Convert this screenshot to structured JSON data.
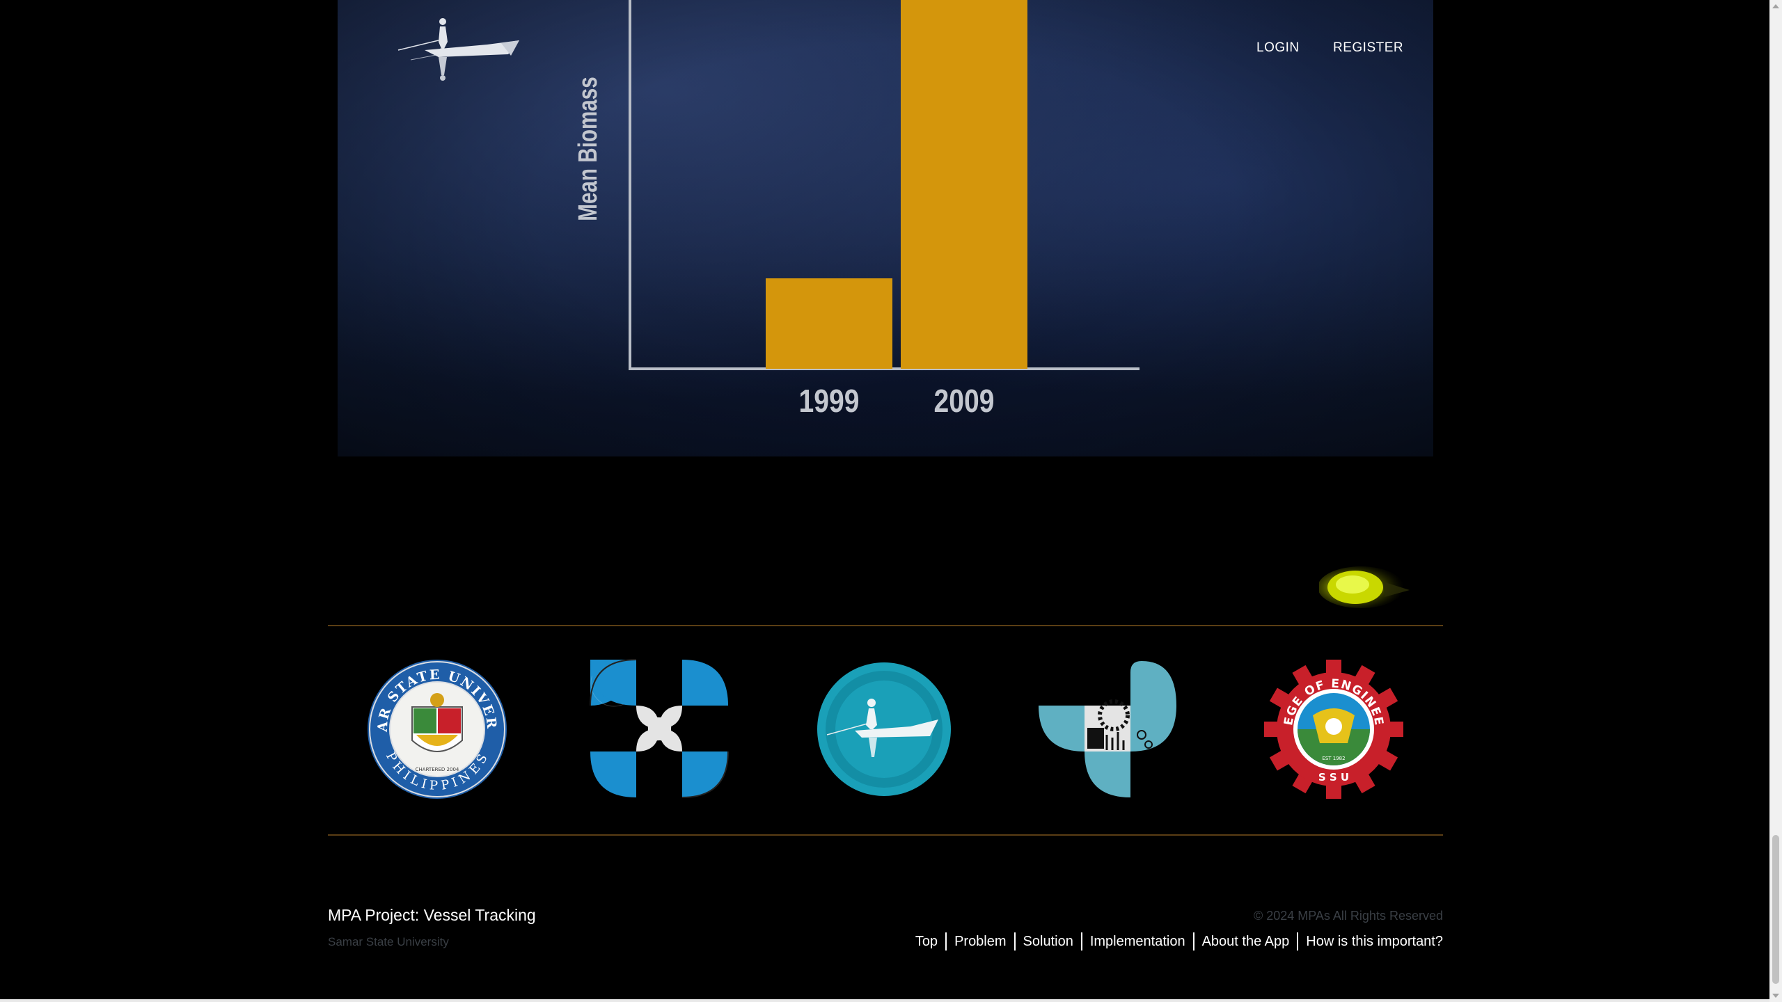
{
  "nav": {
    "login": "LOGIN",
    "register": "REGISTER"
  },
  "chart_data": {
    "type": "bar",
    "categories": [
      "1999",
      "2009"
    ],
    "values": [
      20,
      100
    ],
    "ylabel": "Mean Biomass",
    "xlabel": "",
    "title": "",
    "ylim": [
      0,
      100
    ],
    "bar_color": "#d4960c",
    "grid": false
  },
  "partners": [
    {
      "name": "samar-state-university-seal",
      "seal_top": "SAMAR STATE UNIVERSITY",
      "seal_bottom": "PHILIPPINES",
      "seal_center": "CHARTERED 2004"
    },
    {
      "name": "dost-logo"
    },
    {
      "name": "mpa-vessel-tracking-logo"
    },
    {
      "name": "dost-pcieerd-logo"
    },
    {
      "name": "ssu-college-of-engineering-seal",
      "seal_ring": "COLLEGE OF ENGINEERING",
      "seal_bottom": "S S U",
      "seal_est": "EST 1982"
    }
  ],
  "footer": {
    "title": "MPA Project: Vessel Tracking",
    "subtitle": "Samar State University",
    "copyright": "© 2024 MPAs All Rights Reserved",
    "links": [
      "Top",
      "Problem",
      "Solution",
      "Implementation",
      "About the App",
      "How is this important?"
    ]
  },
  "colors": {
    "accent_gold": "#d4960c",
    "divider": "#5b3e14",
    "teal": "#1aa0b8",
    "blue": "#1b8fcf",
    "red": "#c8202a"
  }
}
